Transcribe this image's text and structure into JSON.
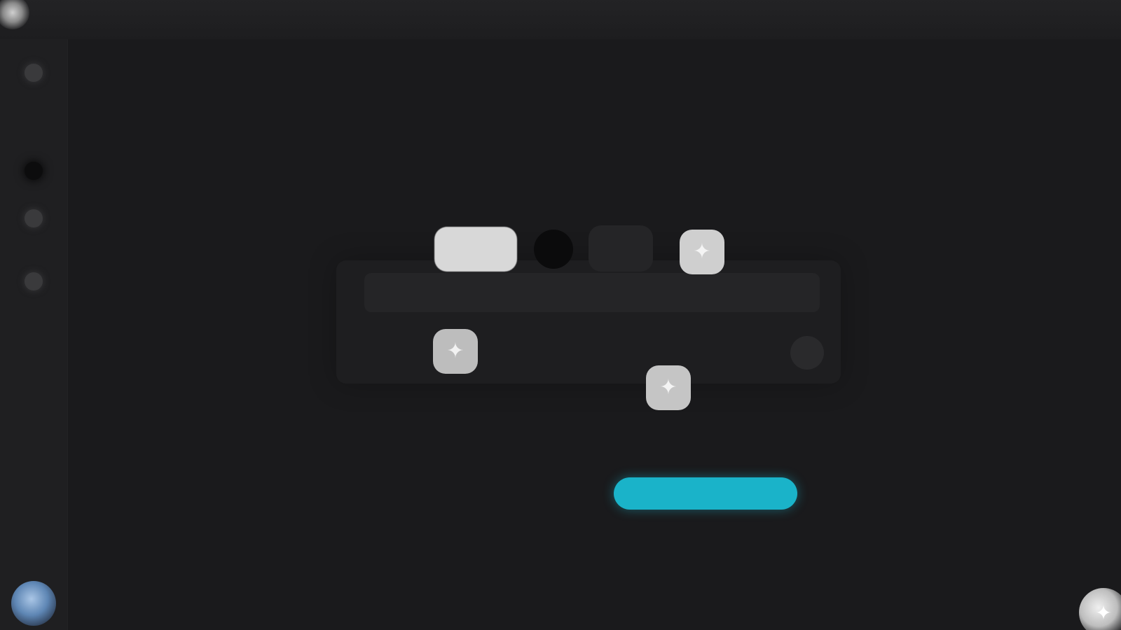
{
  "window": {
    "title": ""
  },
  "sidebar": {
    "items": [
      {
        "icon": "home-icon"
      },
      {
        "icon": "grid-icon",
        "active": true
      },
      {
        "icon": "folder-icon"
      },
      {
        "icon": "settings-icon"
      }
    ],
    "avatar_icon": "user-avatar"
  },
  "toolbar": {
    "mode_chip_label": "",
    "record_icon": "record-icon",
    "secondary_chip_label": "",
    "sparkle_icon": "sparkle-icon",
    "sparkle_glyph": "✦"
  },
  "panel": {
    "left_action_glyph": "✦",
    "center_action_glyph": "✦",
    "right_action_icon": "more-icon"
  },
  "primary_action": {
    "label": ""
  },
  "corner_action": {
    "glyph": "✦",
    "icon": "sparkle-icon"
  },
  "colors": {
    "background": "#1a1a1c",
    "accent": "#1ab3c9"
  }
}
